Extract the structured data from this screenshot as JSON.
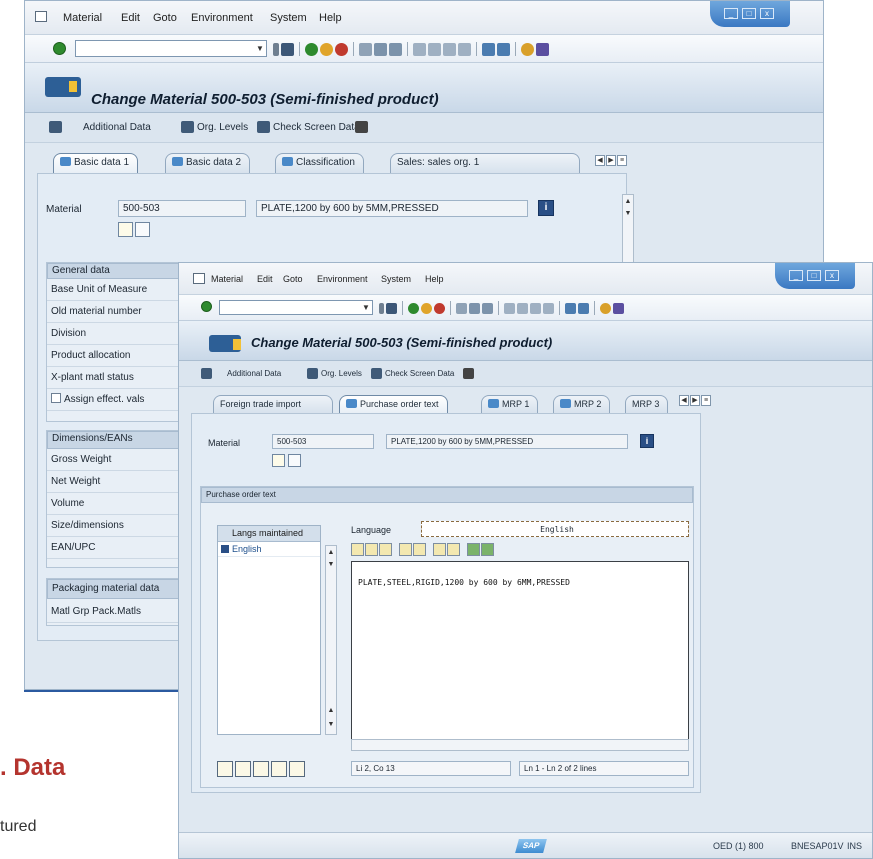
{
  "menu": [
    "Material",
    "Edit",
    "Goto",
    "Environment",
    "System",
    "Help"
  ],
  "window_buttons": [
    "_",
    "□",
    "x"
  ],
  "back_window": {
    "title": "Change Material 500-503 (Semi-finished product)",
    "app_toolbar": [
      "Additional Data",
      "Org. Levels",
      "Check Screen Data"
    ],
    "tabs": [
      "Basic data 1",
      "Basic data 2",
      "Classification",
      "Sales: sales org. 1"
    ],
    "material_label": "Material",
    "material_number": "500-503",
    "material_desc": "PLATE,1200 by 600 by 5MM,PRESSED",
    "general_header": "General data",
    "general_rows": [
      "Base Unit of Measure",
      "Old material number",
      "Division",
      "Product allocation",
      "X-plant matl status"
    ],
    "assign_checkbox": "Assign effect. vals",
    "dimensions_header": "Dimensions/EANs",
    "dimensions_rows": [
      "Gross Weight",
      "Net Weight",
      "Volume",
      "Size/dimensions",
      "EAN/UPC"
    ],
    "packaging_header": "Packaging material data",
    "packaging_rows": [
      "Matl Grp Pack.Matls"
    ]
  },
  "front_window": {
    "title": "Change Material 500-503 (Semi-finished product)",
    "app_toolbar": [
      "Additional Data",
      "Org. Levels",
      "Check Screen Data"
    ],
    "tabs": [
      "Foreign trade import",
      "Purchase order text",
      "MRP 1",
      "MRP 2",
      "MRP 3"
    ],
    "material_label": "Material",
    "material_number": "500-503",
    "material_desc": "PLATE,1200 by 600 by 5MM,PRESSED",
    "po_text_header": "Purchase order text",
    "langs_header": "Langs maintained",
    "langs": [
      "English"
    ],
    "language_label": "Language",
    "language_value": "English",
    "editor_text": "PLATE,STEEL,RIGID,1200 by 600 by 6MM,PRESSED",
    "cursor_pos": "Li 2, Co 13",
    "line_info": "Ln 1 - Ln 2 of 2 lines",
    "status_logo": "SAP",
    "status_system": "OED (1) 800",
    "status_server": "BNESAP01V",
    "status_mode": "INS"
  },
  "background_text": {
    "red_fragment": ". Data",
    "gray_fragment": "tured"
  }
}
